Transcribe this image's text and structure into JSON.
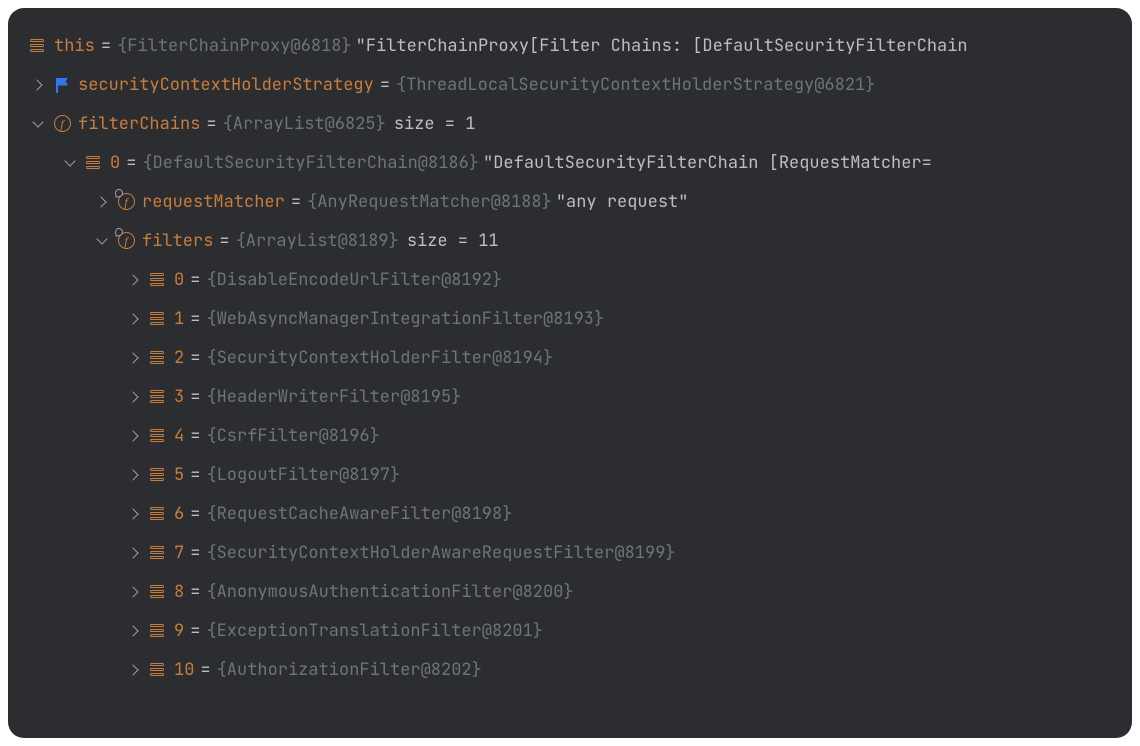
{
  "root": {
    "name": "this",
    "type": "{FilterChainProxy@6818}",
    "value": "\"FilterChainProxy[Filter Chains: [DefaultSecurityFilterChain"
  },
  "strategy": {
    "name": "securityContextHolderStrategy",
    "type": "{ThreadLocalSecurityContextHolderStrategy@6821}"
  },
  "filterChains": {
    "name": "filterChains",
    "type": "{ArrayList@6825}",
    "size": "size = 1"
  },
  "chain0": {
    "index": "0",
    "type": "{DefaultSecurityFilterChain@8186}",
    "value": "\"DefaultSecurityFilterChain [RequestMatcher="
  },
  "requestMatcher": {
    "name": "requestMatcher",
    "type": "{AnyRequestMatcher@8188}",
    "value": "\"any request\""
  },
  "filters": {
    "name": "filters",
    "type": "{ArrayList@8189}",
    "size": "size = 11",
    "items": [
      {
        "index": "0",
        "type": "{DisableEncodeUrlFilter@8192}"
      },
      {
        "index": "1",
        "type": "{WebAsyncManagerIntegrationFilter@8193}"
      },
      {
        "index": "2",
        "type": "{SecurityContextHolderFilter@8194}"
      },
      {
        "index": "3",
        "type": "{HeaderWriterFilter@8195}"
      },
      {
        "index": "4",
        "type": "{CsrfFilter@8196}"
      },
      {
        "index": "5",
        "type": "{LogoutFilter@8197}"
      },
      {
        "index": "6",
        "type": "{RequestCacheAwareFilter@8198}"
      },
      {
        "index": "7",
        "type": "{SecurityContextHolderAwareRequestFilter@8199}"
      },
      {
        "index": "8",
        "type": "{AnonymousAuthenticationFilter@8200}"
      },
      {
        "index": "9",
        "type": "{ExceptionTranslationFilter@8201}"
      },
      {
        "index": "10",
        "type": "{AuthorizationFilter@8202}"
      }
    ]
  },
  "eq": "="
}
